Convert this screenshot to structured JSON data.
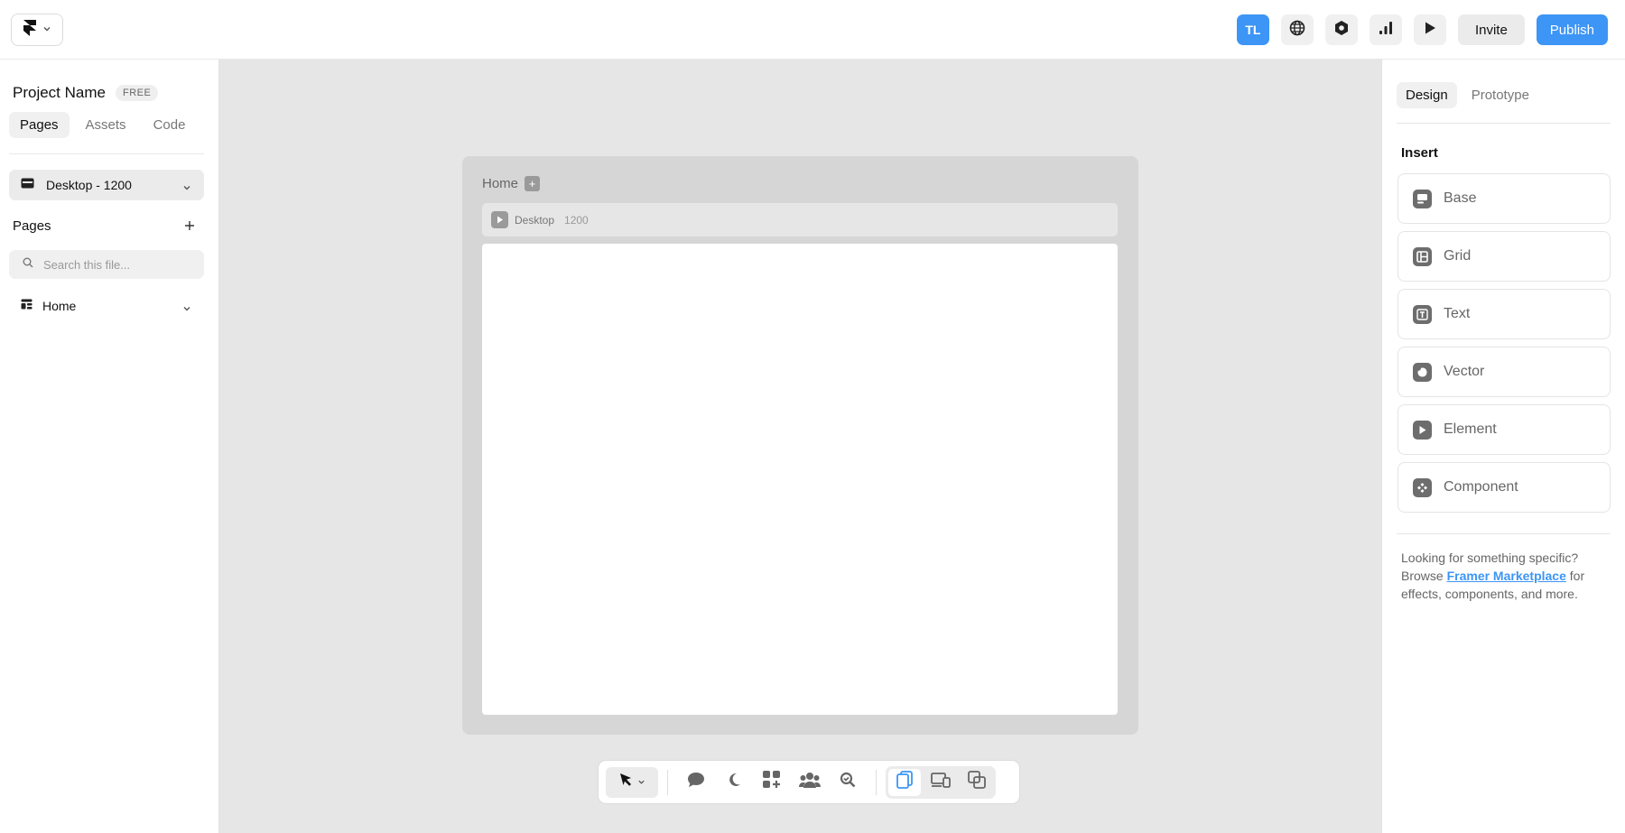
{
  "topbar": {
    "avatar_initials": "TL",
    "invite_label": "Invite",
    "publish_label": "Publish"
  },
  "left_panel": {
    "project_name": "Project Name",
    "plan_badge": "FREE",
    "tabs": [
      {
        "label": "Pages",
        "active": true
      },
      {
        "label": "Assets",
        "active": false
      },
      {
        "label": "Code",
        "active": false
      }
    ],
    "breakpoint_label": "Desktop - 1200",
    "pages_header": "Pages",
    "search_placeholder": "Search this file...",
    "pages": [
      {
        "label": "Home"
      }
    ]
  },
  "canvas": {
    "frame_title": "Home",
    "breakpoint_name": "Desktop",
    "breakpoint_width": "1200"
  },
  "right_panel": {
    "tabs": [
      {
        "label": "Design",
        "active": true
      },
      {
        "label": "Prototype",
        "active": false
      }
    ],
    "insert_title": "Insert",
    "insert_items": [
      {
        "label": "Base",
        "icon": "base-icon"
      },
      {
        "label": "Grid",
        "icon": "grid-icon"
      },
      {
        "label": "Text",
        "icon": "text-icon"
      },
      {
        "label": "Vector",
        "icon": "vector-icon"
      },
      {
        "label": "Element",
        "icon": "element-icon"
      },
      {
        "label": "Component",
        "icon": "component-icon"
      }
    ],
    "help": {
      "line1": "Looking for something specific? Browse ",
      "link": "Framer Marketplace",
      "line2": " for effects, components, and more."
    }
  },
  "colors": {
    "accent": "#3d95f5",
    "canvas_bg": "#e6e6e6",
    "frame_bg": "#d6d6d6"
  }
}
